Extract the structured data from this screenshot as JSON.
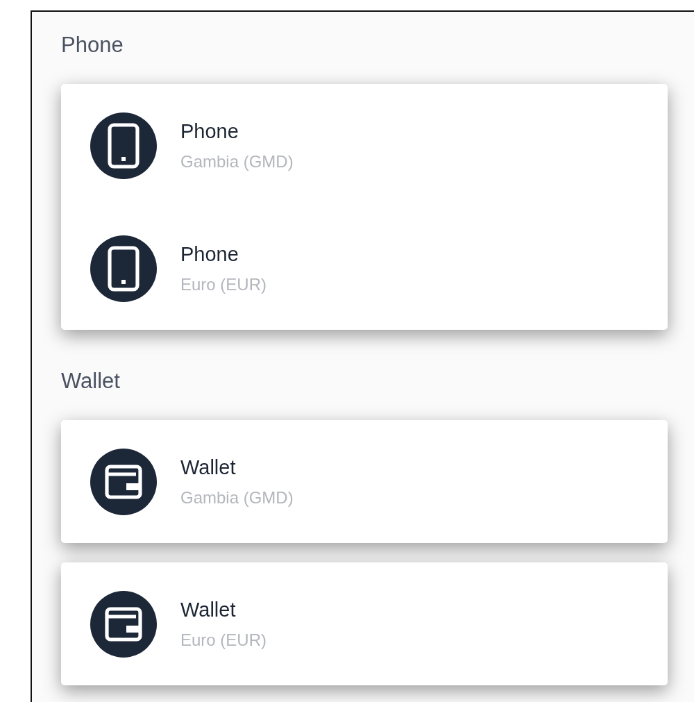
{
  "sections": [
    {
      "title": "Phone",
      "cards": [
        {
          "items": [
            {
              "kind": "phone",
              "title": "Phone",
              "subtitle": "Gambia (GMD)"
            },
            {
              "kind": "phone",
              "title": "Phone",
              "subtitle": "Euro (EUR)"
            }
          ]
        }
      ]
    },
    {
      "title": "Wallet",
      "cards": [
        {
          "items": [
            {
              "kind": "wallet",
              "title": "Wallet",
              "subtitle": "Gambia (GMD)"
            }
          ]
        },
        {
          "items": [
            {
              "kind": "wallet",
              "title": "Wallet",
              "subtitle": "Euro (EUR)"
            }
          ]
        }
      ]
    }
  ]
}
